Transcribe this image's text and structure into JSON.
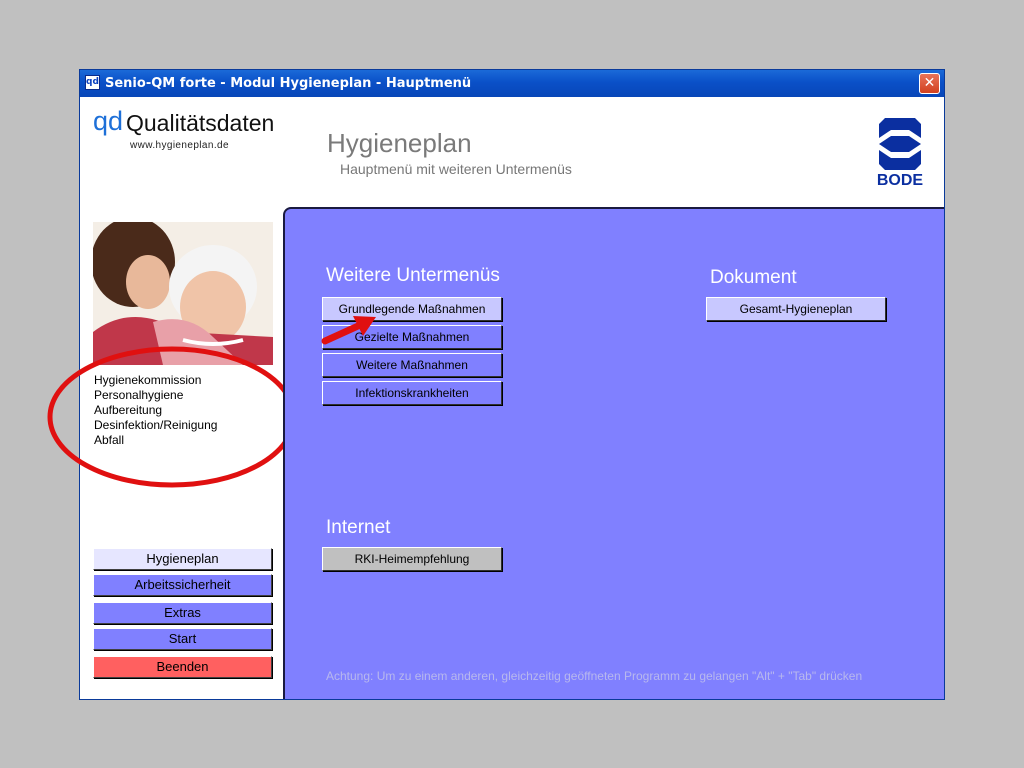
{
  "window": {
    "title": "Senio-QM forte - Modul Hygieneplan - Hauptmenü",
    "app_icon": "qd",
    "close_label": "✕"
  },
  "header": {
    "brand_qd": "qd",
    "brand_name": "Qualitätsdaten",
    "brand_url": "www.hygieneplan.de",
    "title": "Hygieneplan",
    "subtitle": "Hauptmenü mit weiteren Untermenüs",
    "logo_text": "BODE"
  },
  "sidebar": {
    "photo_icon": "grandmother-child-photo",
    "links": [
      "Hygienekommission",
      "Personalhygiene",
      "Aufbereitung",
      "Desinfektion/Reinigung",
      "Abfall"
    ],
    "buttons": [
      "Hygieneplan",
      "Arbeitssicherheit",
      "Extras",
      "Start",
      "Beenden"
    ]
  },
  "main": {
    "submenus_heading": "Weitere Untermenüs",
    "submenu_buttons": [
      "Grundlegende Maßnahmen",
      "Gezielte Maßnahmen",
      "Weitere Maßnahmen",
      "Infektionskrankheiten"
    ],
    "document_heading": "Dokument",
    "document_button": "Gesamt-Hygieneplan",
    "internet_heading": "Internet",
    "internet_button": "RKI-Heimempfehlung",
    "footer_note": "Achtung: Um zu einem anderen, gleichzeitig geöffneten Programm zu gelangen \"Alt\" + \"Tab\" drücken"
  },
  "colors": {
    "panel": "#8080ff",
    "button_light": "#e6e6ff",
    "button_danger": "#ff6060",
    "annotation": "#e01010",
    "titlebar": "#0a50c8",
    "logo": "#0b2fa0"
  }
}
